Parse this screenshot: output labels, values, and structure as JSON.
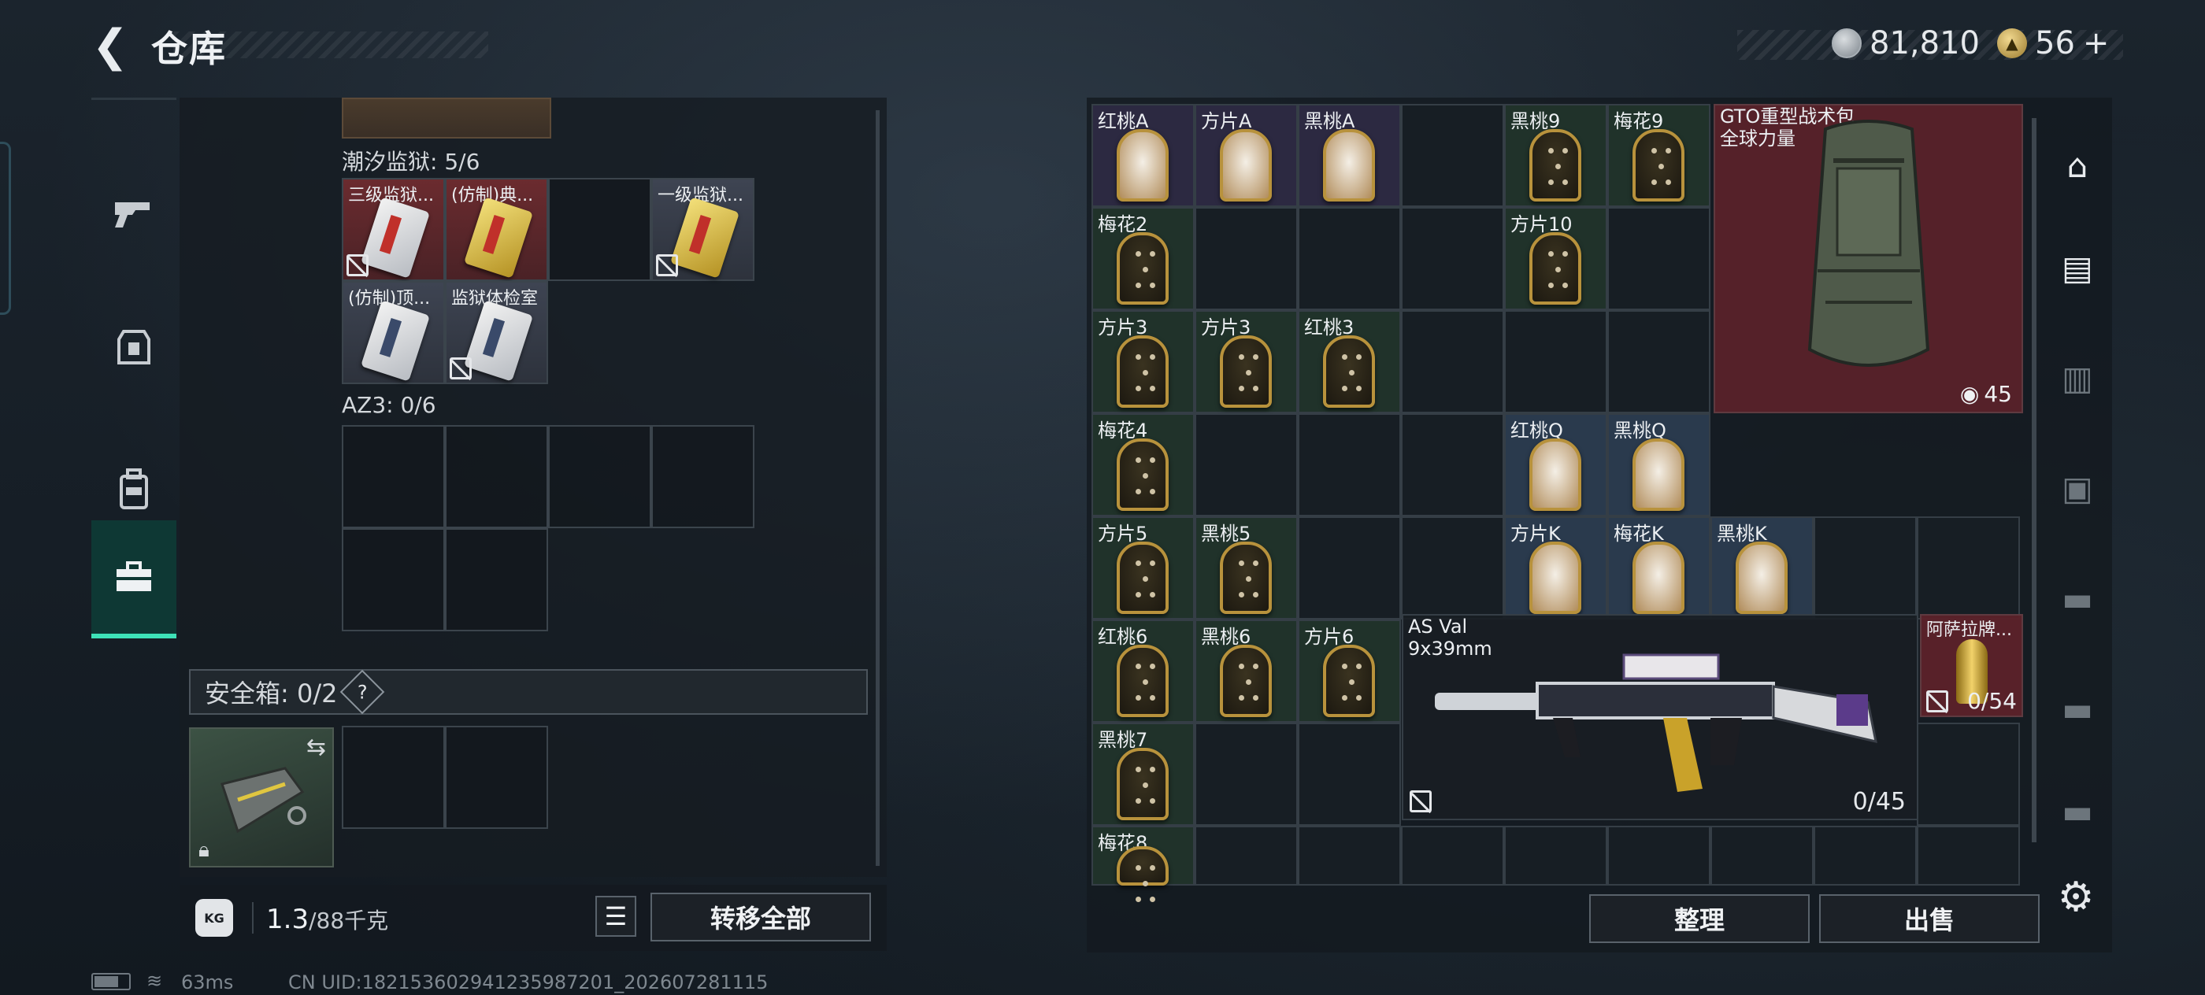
{
  "header": {
    "title": "仓库",
    "currency1": "81,810",
    "currency2": "56",
    "plus": "+"
  },
  "left_panel": {
    "section1_label": "潮汐监狱: 5/6",
    "section1_items": [
      {
        "label": "三级监狱...",
        "style": "red",
        "card": "red",
        "bind_flag": true
      },
      {
        "label": "(仿制)典...",
        "style": "red",
        "card": "gold",
        "bind_flag": false
      },
      {
        "label": "",
        "style": "empty",
        "card": "",
        "bind_flag": false
      },
      {
        "label": "一级监狱...",
        "style": "gray",
        "card": "gold",
        "bind_flag": true
      },
      {
        "label": "(仿制)顶...",
        "style": "gray",
        "card": "silver",
        "bind_flag": false
      },
      {
        "label": "监狱体检室",
        "style": "gray",
        "card": "silver",
        "bind_flag": true
      }
    ],
    "section2_label": "AZ3: 0/6",
    "safe_label": "安全箱: 0/2",
    "safe_help": "?",
    "weight_value": "1.3",
    "weight_max": "/88千克",
    "transfer_all": "转移全部"
  },
  "right_panel": {
    "cells": [
      {
        "label": "红桃A",
        "bg": "bg-purple",
        "face": true
      },
      {
        "label": "方片A",
        "bg": "bg-purple",
        "face": true
      },
      {
        "label": "黑桃A",
        "bg": "bg-purple",
        "face": true
      },
      {
        "label": "",
        "bg": "",
        "face": false
      },
      {
        "label": "黑桃9",
        "bg": "bg-green",
        "face": false
      },
      {
        "label": "梅花9",
        "bg": "bg-green",
        "face": false
      },
      {
        "label": "梅花2",
        "bg": "bg-green",
        "face": false
      },
      {
        "label": "方片10",
        "bg": "bg-green",
        "face": false
      },
      {
        "label": "方片3",
        "bg": "bg-green",
        "face": false
      },
      {
        "label": "方片3",
        "bg": "bg-green",
        "face": false
      },
      {
        "label": "红桃3",
        "bg": "bg-green",
        "face": false
      },
      {
        "label": "梅花4",
        "bg": "bg-green",
        "face": false
      },
      {
        "label": "红桃Q",
        "bg": "bg-blue",
        "face": true
      },
      {
        "label": "黑桃Q",
        "bg": "bg-blue",
        "face": true
      },
      {
        "label": "方片5",
        "bg": "bg-green",
        "face": false
      },
      {
        "label": "黑桃5",
        "bg": "bg-green",
        "face": false
      },
      {
        "label": "方片K",
        "bg": "bg-blue",
        "face": true
      },
      {
        "label": "梅花K",
        "bg": "bg-blue",
        "face": true
      },
      {
        "label": "黑桃K",
        "bg": "bg-blue",
        "face": true
      },
      {
        "label": "红桃6",
        "bg": "bg-green",
        "face": false
      },
      {
        "label": "黑桃6",
        "bg": "bg-green",
        "face": false
      },
      {
        "label": "方片6",
        "bg": "bg-green",
        "face": false
      },
      {
        "label": "黑桃7",
        "bg": "bg-green",
        "face": false
      },
      {
        "label": "梅花8",
        "bg": "bg-green",
        "face": false
      }
    ],
    "bag_name": "GTO重型战术包",
    "bag_brand": "全球力量",
    "bag_count": "45",
    "gun_name": "AS Val",
    "gun_caliber": "9x39mm",
    "gun_ammo": "0/45",
    "ammo_name": "阿萨拉牌...",
    "ammo_count": "0/54",
    "organize": "整理",
    "sell": "出售"
  },
  "status_bar": {
    "ping": "63ms",
    "uid": "CN UID:182153602941235987201_202607281115"
  },
  "colors": {
    "accent": "#3ee2b8",
    "red_item": "#6b2b2f",
    "gold_frame": "#b8923c"
  },
  "icons": [
    "back-arrow-icon",
    "silver-coin-icon",
    "gold-coin-icon",
    "gun-icon",
    "armor-icon",
    "backpack-icon",
    "toolbox-icon",
    "list-icon",
    "weight-icon",
    "lock-icon",
    "swap-icon",
    "settings-icon"
  ]
}
